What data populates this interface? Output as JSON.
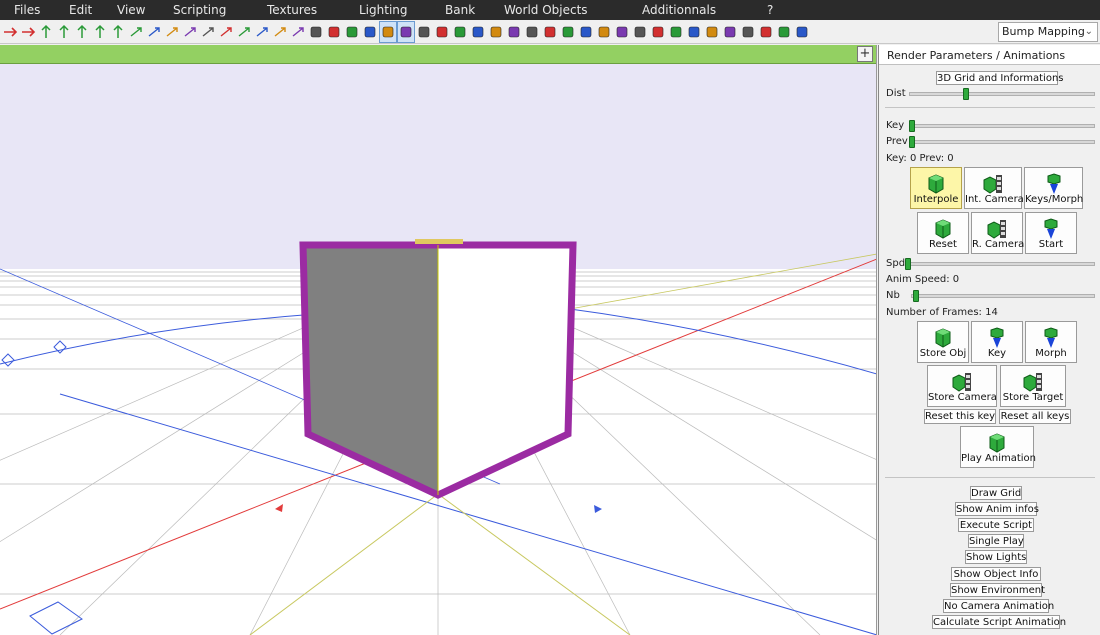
{
  "menu": [
    "Files",
    "Edit",
    "View",
    "Scripting",
    "Textures",
    "Lighting",
    "Bank",
    "World Objects",
    "Additionnals",
    "?"
  ],
  "toolbar": {
    "icons": [
      "arrow-left-icon",
      "arrow-right-icon",
      "move-up-icon",
      "move-down-icon",
      "move-x-icon",
      "move-y-icon",
      "move-z-icon",
      "rotate-x-icon",
      "rotate-y-icon",
      "rotate-z-icon",
      "scale-x-icon",
      "scale-y-icon",
      "scale-z-icon",
      "scale-all-icon",
      "skew-x-icon",
      "skew-y-icon",
      "skew-z-icon",
      "bend-icon",
      "twist-icon",
      "taper-icon",
      "extrude-icon",
      "select-icon",
      "select-box-icon",
      "cube-icon",
      "cone-icon",
      "pyramid-icon",
      "light-bulb-icon",
      "spotlight-icon",
      "camera-icon",
      "bulb-icon",
      "record-icon",
      "play-icon",
      "object-icon",
      "mesh-icon",
      "sphere-icon",
      "teapot-icon",
      "clone-icon",
      "bitmap-icon",
      "texture-icon",
      "bottle-icon",
      "gear-icon",
      "frame-icon",
      "stop-icon",
      "warning-icon",
      "ball-icon"
    ],
    "render_mode": "Bump Mapping"
  },
  "panel": {
    "title": "Render Parameters / Animations",
    "grid_button": "3D Grid and Informations",
    "dist_label": "Dist",
    "dist_value": 0.3,
    "key_label": "Key",
    "prev_label": "Prev",
    "key_status": "Key: 0  Prev: 0",
    "anim_buttons_row1": [
      {
        "label": "Interpole",
        "icon": "cube-icon",
        "active": true
      },
      {
        "label": "Int. Camera",
        "icon": "camera-film-icon",
        "active": false
      },
      {
        "label": "Keys/Morph",
        "icon": "morph-icon",
        "active": false
      }
    ],
    "anim_buttons_row2": [
      {
        "label": "Reset",
        "icon": "cube-icon"
      },
      {
        "label": "R. Camera",
        "icon": "camera-film-icon"
      },
      {
        "label": "Start",
        "icon": "morph-icon"
      }
    ],
    "spd_label": "Spd",
    "anim_speed": "Anim Speed: 0",
    "nb_label": "Nb",
    "frames": "Number of Frames: 14",
    "store_row": [
      {
        "label": "Store Obj",
        "icon": "cube-icon"
      },
      {
        "label": "Key",
        "icon": "key-icon"
      },
      {
        "label": "Morph",
        "icon": "morph-icon"
      }
    ],
    "store_row2": [
      {
        "label": "Store Camera",
        "icon": "camera-film-icon"
      },
      {
        "label": "Store Target",
        "icon": "camera-film-icon"
      }
    ],
    "reset_this_key": "Reset this key",
    "reset_all_keys": "Reset all keys",
    "play_animation": "Play Animation",
    "toggles": [
      "Draw Grid",
      "Show Anim infos",
      "Execute Script",
      "Single Play",
      "Show Lights",
      "Show Object Info",
      "Show Environment",
      "No Camera Animation",
      "Calculate Script Animation"
    ]
  },
  "colors": {
    "viewport_bar": "#93d062",
    "sky": "#e8e6f6",
    "cube_frame": "#9b2ba2",
    "accent_green": "#2eaa3c"
  }
}
